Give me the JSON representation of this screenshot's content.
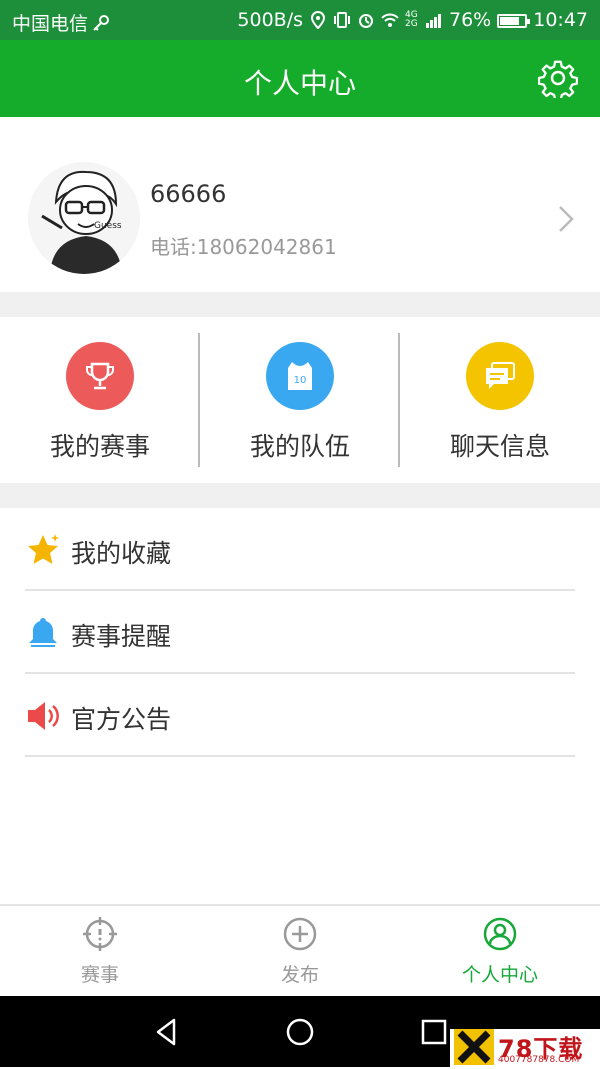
{
  "status_bar": {
    "carrier": "中国电信",
    "speed": "500B/s",
    "network": "4G 2G",
    "battery": "76%",
    "battery_level": 0.76,
    "time": "10:47"
  },
  "header": {
    "title": "个人中心",
    "settings_icon": "gear-icon"
  },
  "profile": {
    "username": "66666",
    "phone": "电话:18062042861",
    "avatar_text": "Guess"
  },
  "quick_actions": [
    {
      "label": "我的赛事",
      "icon": "trophy-icon",
      "color": "#ec5a5a"
    },
    {
      "label": "我的队伍",
      "icon": "jersey-icon",
      "color": "#3aa8f0",
      "jersey_number": "10"
    },
    {
      "label": "聊天信息",
      "icon": "chat-icon",
      "color": "#f5c400"
    }
  ],
  "list": [
    {
      "label": "我的收藏",
      "icon": "star-icon",
      "color": "#f4b400"
    },
    {
      "label": "赛事提醒",
      "icon": "bell-icon",
      "color": "#3aa8f0"
    },
    {
      "label": "官方公告",
      "icon": "speaker-icon",
      "color": "#ec4a4a"
    }
  ],
  "tabs": [
    {
      "label": "赛事",
      "icon": "target-icon",
      "active": false
    },
    {
      "label": "发布",
      "icon": "plus-circle-icon",
      "active": false
    },
    {
      "label": "个人中心",
      "icon": "user-circle-icon",
      "active": true
    }
  ],
  "watermark": {
    "brand": "78下载",
    "url": "4007787878.COM"
  },
  "colors": {
    "primary": "#16ac2b",
    "status_bar": "#1d8f3a",
    "active_tab": "#17a83a"
  }
}
